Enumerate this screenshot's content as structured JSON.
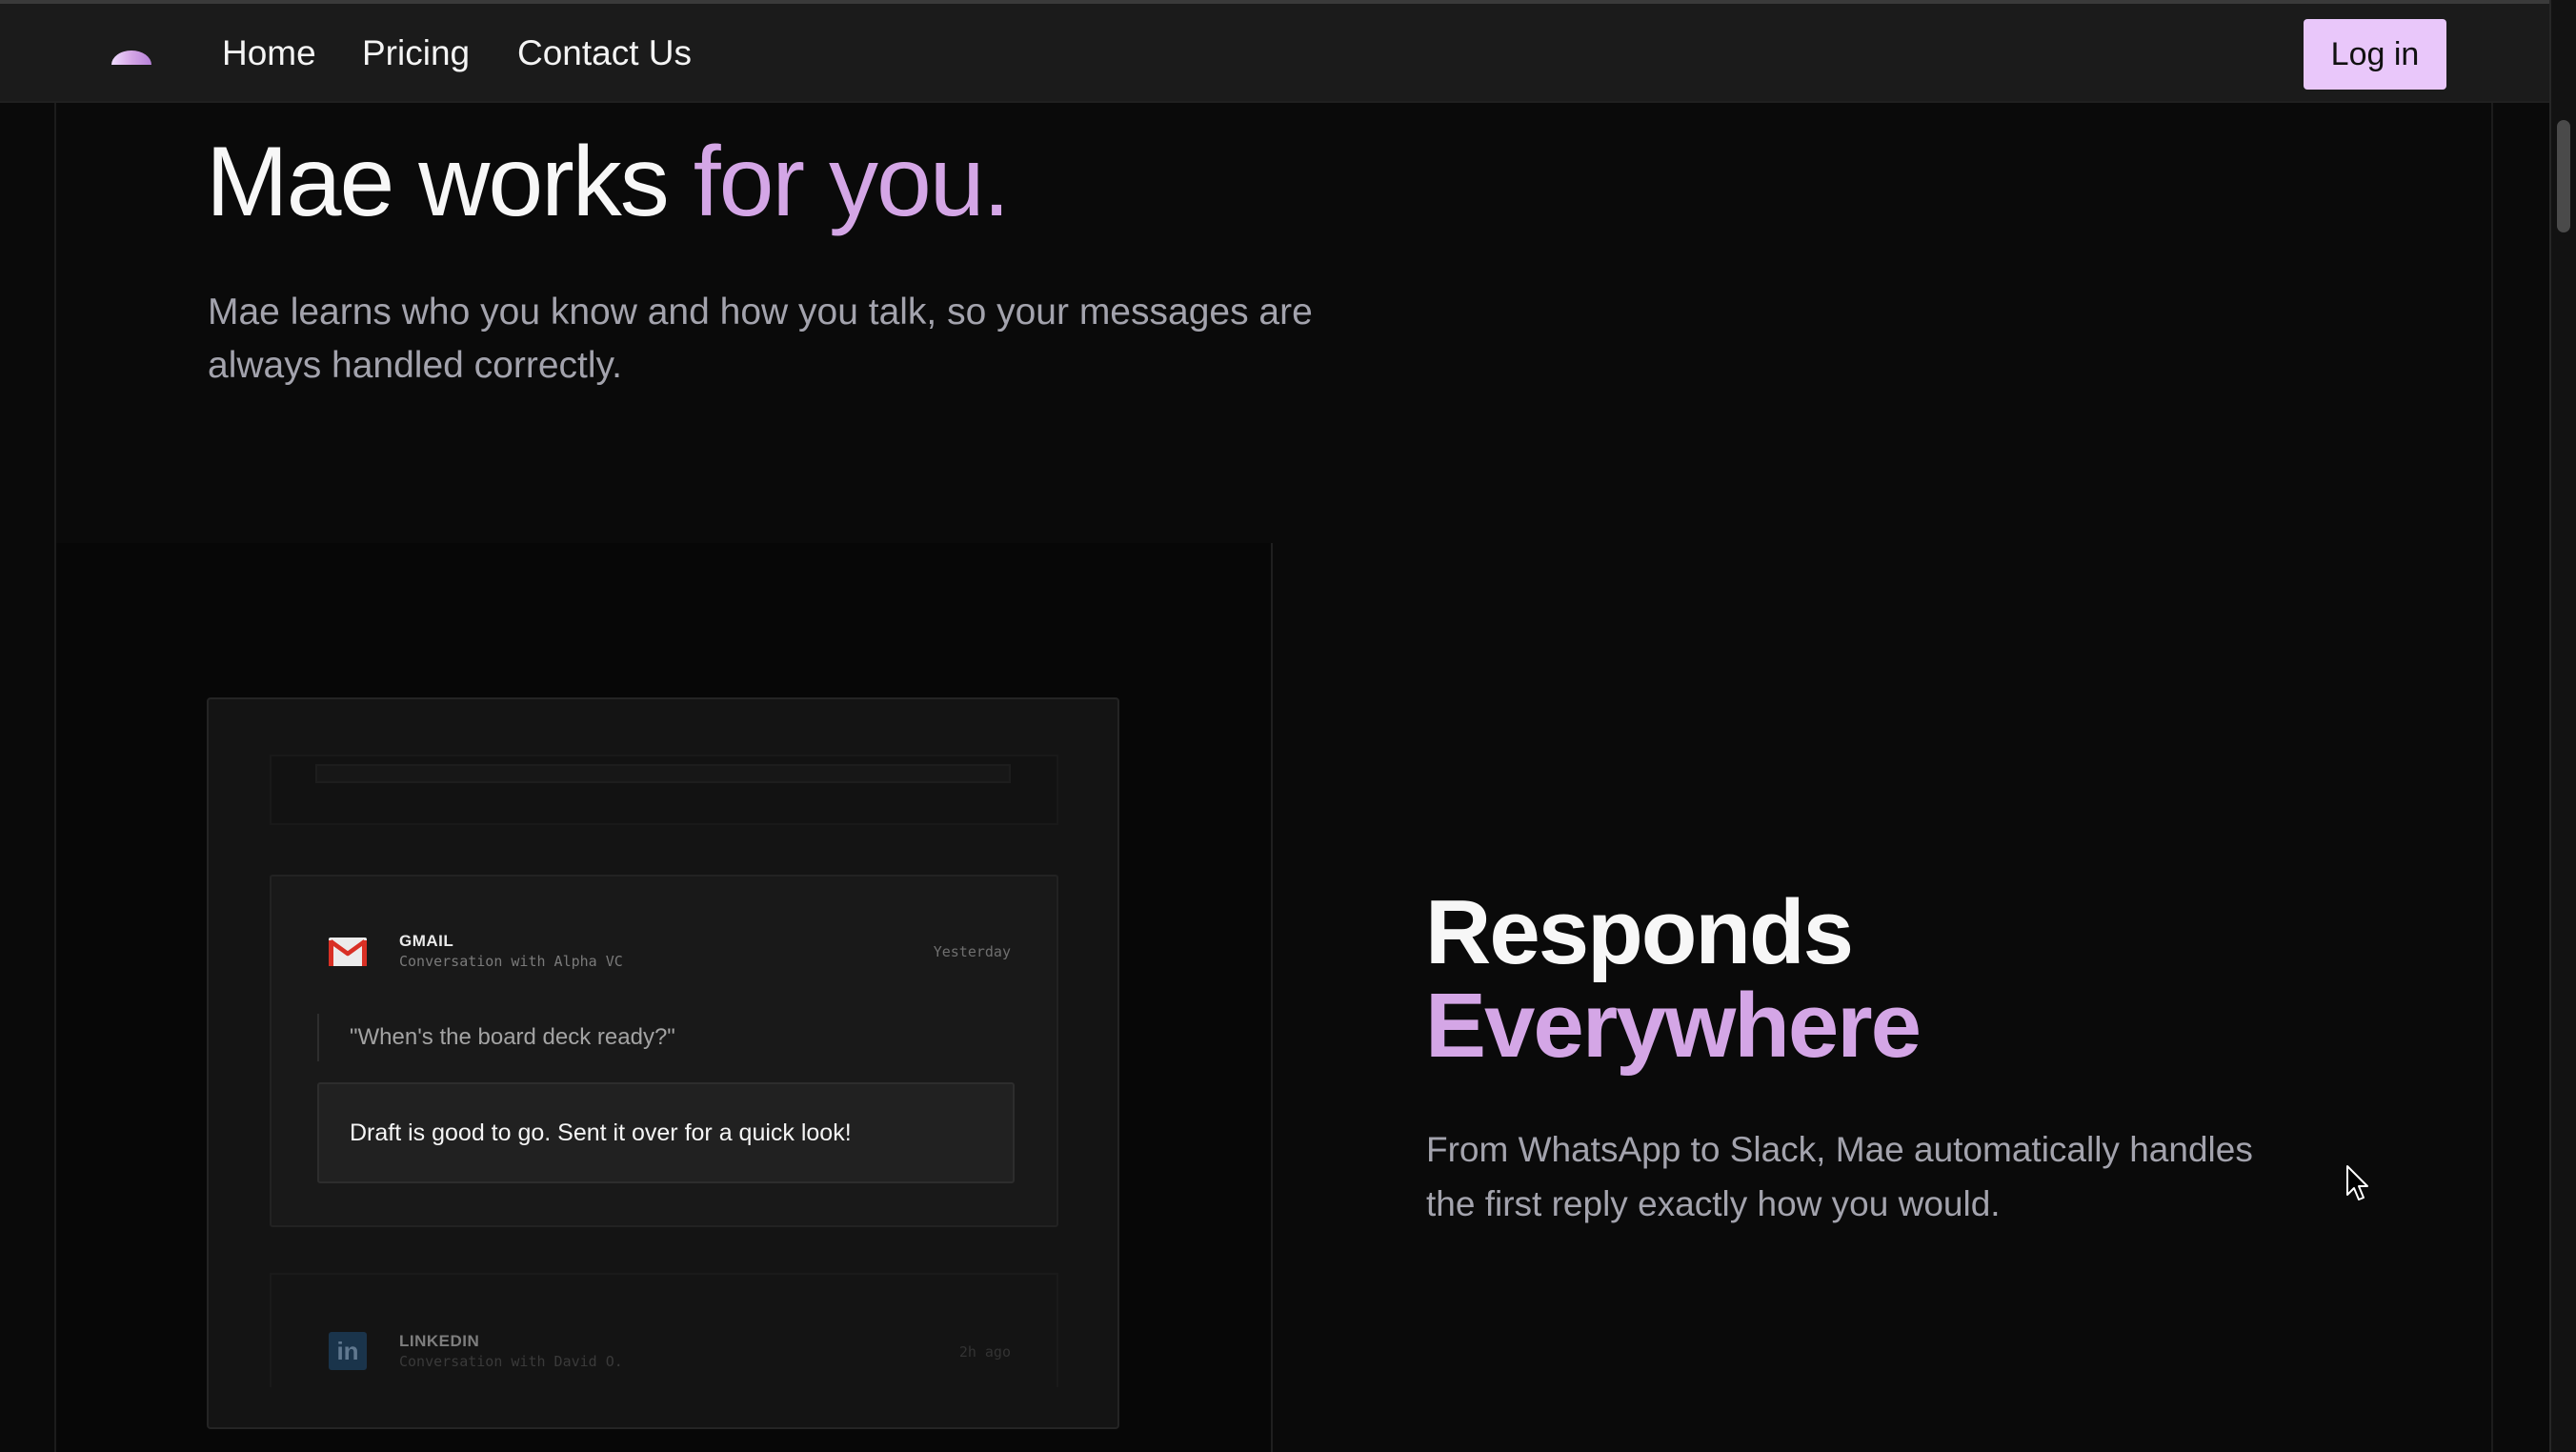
{
  "nav": {
    "links": [
      "Home",
      "Pricing",
      "Contact Us"
    ],
    "login_label": "Log in"
  },
  "hero": {
    "title_main": "Mae works ",
    "title_accent": "for you.",
    "subtitle": "Mae learns who you know and how you talk, so your messages are always handled correctly."
  },
  "feature": {
    "title_line1": "Responds",
    "title_line2": "Everywhere",
    "description": "From WhatsApp to Slack, Mae automatically handles the first reply exactly how you would."
  },
  "mockup": {
    "gmail": {
      "app": "GMAIL",
      "conversation": "Conversation with Alpha VC",
      "time": "Yesterday",
      "incoming": "\"When's the board deck ready?\"",
      "reply": "Draft is good to go. Sent it over for a quick look!"
    },
    "linkedin": {
      "app": "LINKEDIN",
      "conversation": "Conversation with David O.",
      "time": "2h ago"
    }
  },
  "colors": {
    "accent": "#d4a6e6",
    "login_bg": "#e9c7fa",
    "background": "#0a0a0a"
  }
}
